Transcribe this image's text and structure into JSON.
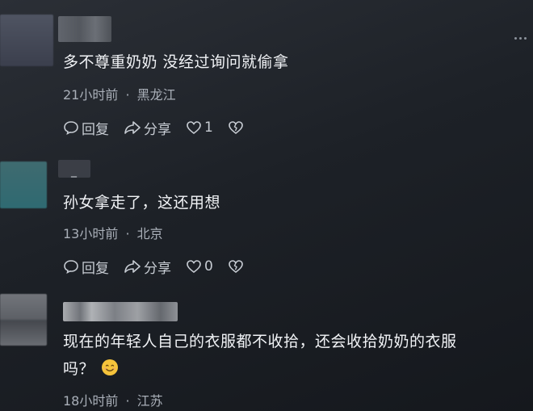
{
  "comments": [
    {
      "text": "多不尊重奶奶 没经过询问就偷拿",
      "time": "21小时前",
      "location": "黑龙江",
      "reply_label": "回复",
      "share_label": "分享",
      "like_count": "1"
    },
    {
      "name": "_",
      "text": "孙女拿走了，这还用想",
      "time": "13小时前",
      "location": "北京",
      "reply_label": "回复",
      "share_label": "分享",
      "like_count": "0"
    },
    {
      "text_line1": "现在的年轻人自己的衣服都不收拾，还会收拾奶奶的衣服",
      "text_line2": "吗？",
      "time": "18小时前",
      "location": "江苏"
    }
  ],
  "meta_separator": "·",
  "icons": {
    "reply": "reply-bubble-icon",
    "share": "share-arrow-icon",
    "like": "heart-icon",
    "dislike": "broken-heart-icon",
    "more": "more-dots-icon",
    "emoji": "smile-emoji-icon"
  },
  "colors": {
    "background": "#1d2127",
    "text": "#f1f3f6",
    "meta": "#a9afb8",
    "action": "#c7ccd3"
  }
}
